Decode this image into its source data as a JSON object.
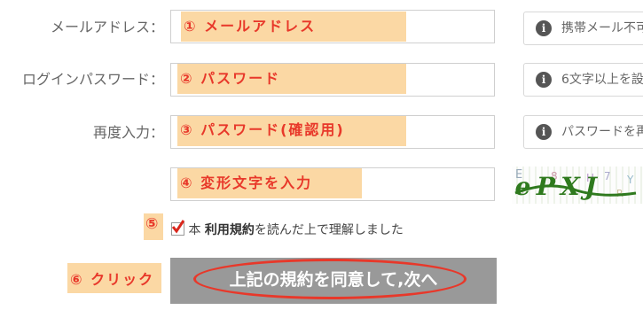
{
  "form": {
    "email_label": "メールアドレス：",
    "password_label": "ログインパスワード：",
    "password_confirm_label": "再度入力：",
    "email_tip": "携帯メール不可",
    "password_tip": "6文字以上を設",
    "password_confirm_tip": "パスワードを再",
    "agree_prefix": "本",
    "agree_terms": "利用規約",
    "agree_suffix": "を読んだ上で理解しました",
    "submit_label": "上記の規約を同意して,次へ",
    "captcha_text": "ePXJ"
  },
  "annotations": {
    "step1": "① メールアドレス",
    "step2": "② パスワード",
    "step3": "③ パスワード(確認用)",
    "step4": "④ 変形文字を入力",
    "step5": "⑤",
    "step6": "⑥ クリック"
  },
  "colors": {
    "highlight": "#fbd8a4",
    "annotation_text": "#e8382a",
    "submit_bg": "#999999"
  }
}
